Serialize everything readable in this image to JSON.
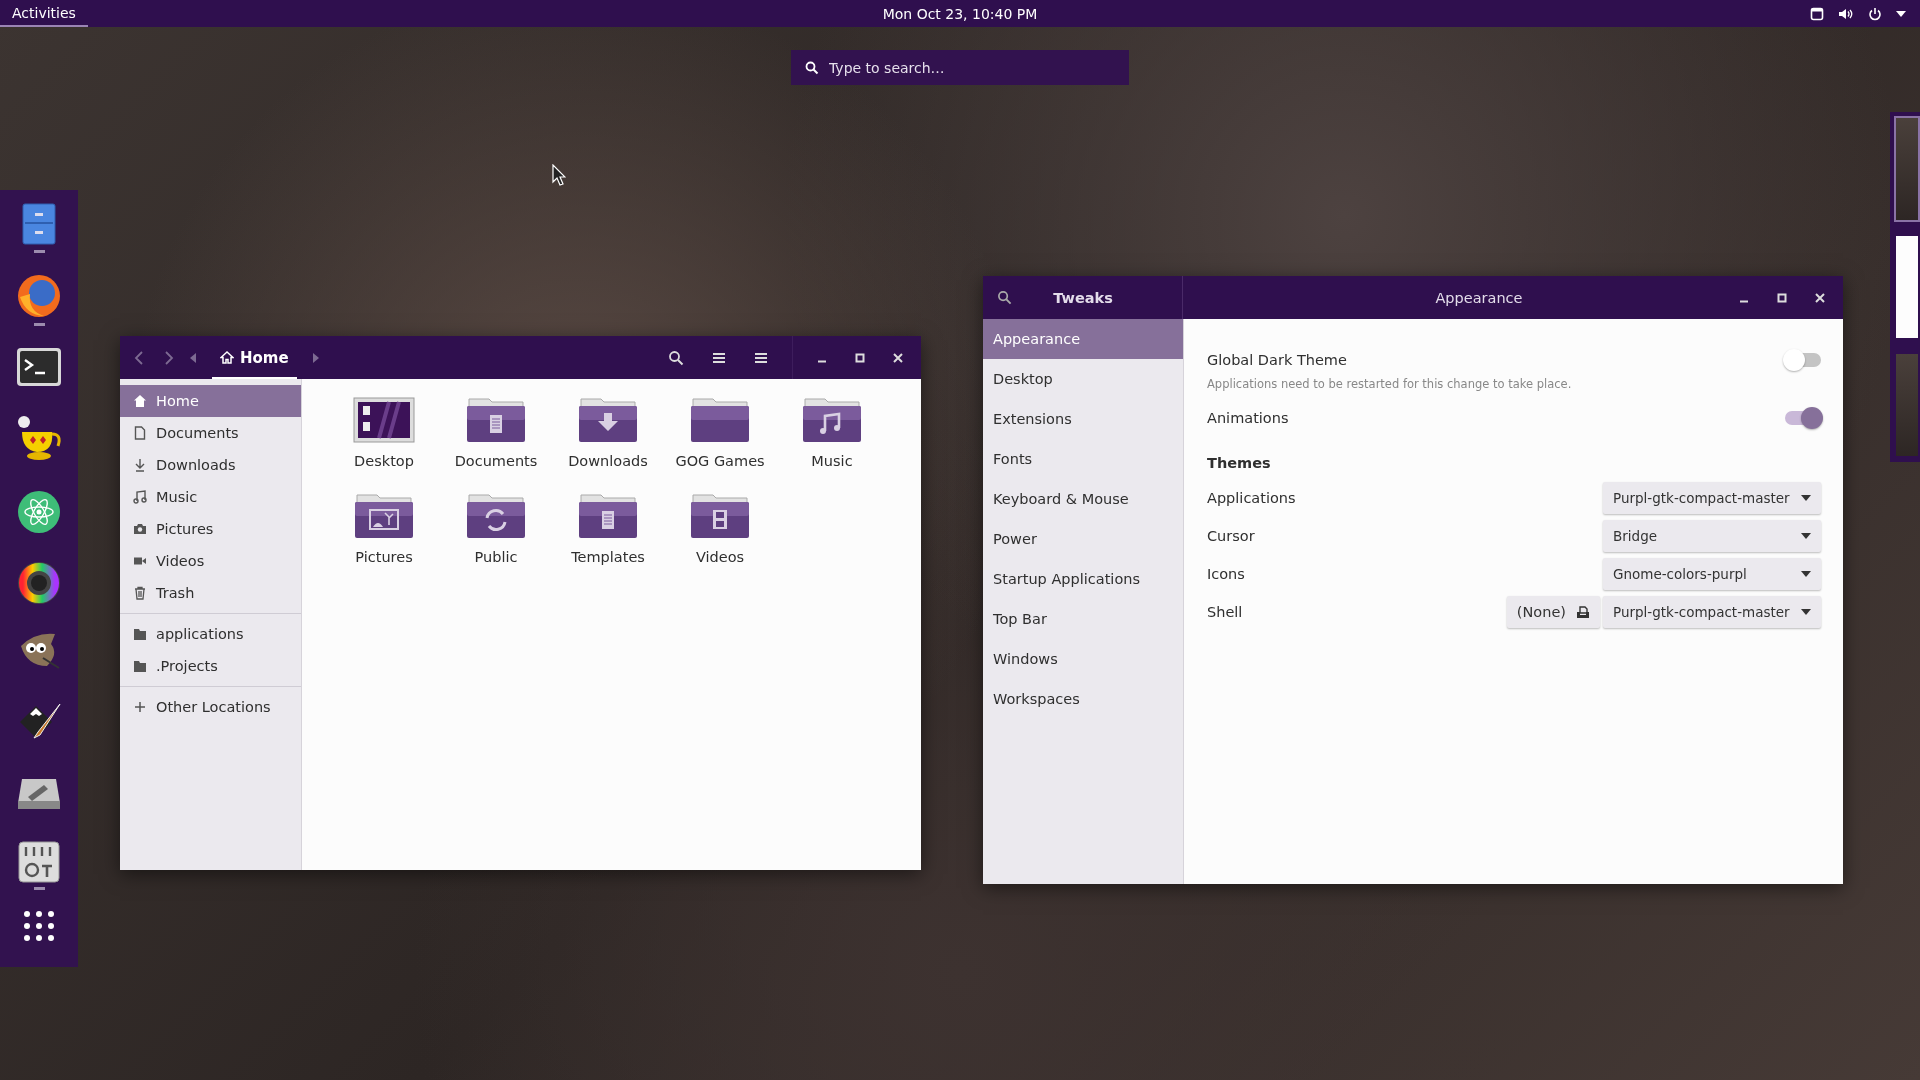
{
  "top_bar": {
    "activities": "Activities",
    "clock": "Mon Oct 23, 10:40 PM"
  },
  "overview_search": {
    "placeholder": "Type to search…"
  },
  "dock": {
    "items": [
      {
        "kind": "files",
        "running": true
      },
      {
        "kind": "browser",
        "running": true
      },
      {
        "kind": "terminal",
        "running": false
      },
      {
        "kind": "lamp",
        "running": false
      },
      {
        "kind": "atom",
        "running": false
      },
      {
        "kind": "color-wheel",
        "running": false
      },
      {
        "kind": "creature",
        "running": false
      },
      {
        "kind": "pen",
        "running": false
      },
      {
        "kind": "disk-tool",
        "running": false
      },
      {
        "kind": "mixer",
        "running": true
      },
      {
        "kind": "app-grid",
        "running": false
      }
    ]
  },
  "workspaces": [
    {
      "kind": "desktop",
      "selected": true
    },
    {
      "kind": "document",
      "selected": false
    },
    {
      "kind": "desktop",
      "selected": false
    }
  ],
  "file_manager": {
    "path": "Home",
    "sidebar": [
      [
        {
          "label": "Home",
          "kind": "home",
          "selected": true
        },
        {
          "label": "Documents",
          "kind": "document",
          "selected": false
        },
        {
          "label": "Downloads",
          "kind": "download",
          "selected": false
        },
        {
          "label": "Music",
          "kind": "music",
          "selected": false
        },
        {
          "label": "Pictures",
          "kind": "camera",
          "selected": false
        },
        {
          "label": "Videos",
          "kind": "video",
          "selected": false
        },
        {
          "label": "Trash",
          "kind": "trash",
          "selected": false
        }
      ],
      [
        {
          "label": "applications",
          "kind": "folder",
          "selected": false
        },
        {
          "label": ".Projects",
          "kind": "folder",
          "selected": false
        }
      ],
      [
        {
          "label": "Other Locations",
          "kind": "plus",
          "selected": false
        }
      ]
    ],
    "items": [
      {
        "label": "Desktop",
        "kind": "desktop"
      },
      {
        "label": "Documents",
        "kind": "documents"
      },
      {
        "label": "Downloads",
        "kind": "downloads"
      },
      {
        "label": "GOG Games",
        "kind": "plain"
      },
      {
        "label": "Music",
        "kind": "music"
      },
      {
        "label": "Pictures",
        "kind": "pictures"
      },
      {
        "label": "Public",
        "kind": "public"
      },
      {
        "label": "Templates",
        "kind": "templates"
      },
      {
        "label": "Videos",
        "kind": "videos"
      }
    ]
  },
  "tweaks": {
    "title": "Tweaks",
    "header": "Appearance",
    "sidebar": [
      {
        "label": "Appearance",
        "selected": true
      },
      {
        "label": "Desktop",
        "selected": false
      },
      {
        "label": "Extensions",
        "selected": false
      },
      {
        "label": "Fonts",
        "selected": false
      },
      {
        "label": "Keyboard & Mouse",
        "selected": false
      },
      {
        "label": "Power",
        "selected": false
      },
      {
        "label": "Startup Applications",
        "selected": false
      },
      {
        "label": "Top Bar",
        "selected": false
      },
      {
        "label": "Windows",
        "selected": false
      },
      {
        "label": "Workspaces",
        "selected": false
      }
    ],
    "rows": [
      {
        "kind": "switch",
        "label": "Global Dark Theme",
        "on": false
      },
      {
        "kind": "note",
        "text": "Applications need to be restarted for this change to take place."
      },
      {
        "kind": "switch",
        "label": "Animations",
        "on": true
      },
      {
        "kind": "heading",
        "label": "Themes"
      },
      {
        "kind": "dropdown",
        "label": "Applications",
        "value": "Purpl-gtk-compact-master"
      },
      {
        "kind": "dropdown",
        "label": "Cursor",
        "value": "Bridge"
      },
      {
        "kind": "dropdown",
        "label": "Icons",
        "value": "Gnome-colors-purpl"
      },
      {
        "kind": "dropdown",
        "label": "Shell",
        "value": "Purpl-gtk-compact-master",
        "extra": "(None)"
      }
    ]
  }
}
